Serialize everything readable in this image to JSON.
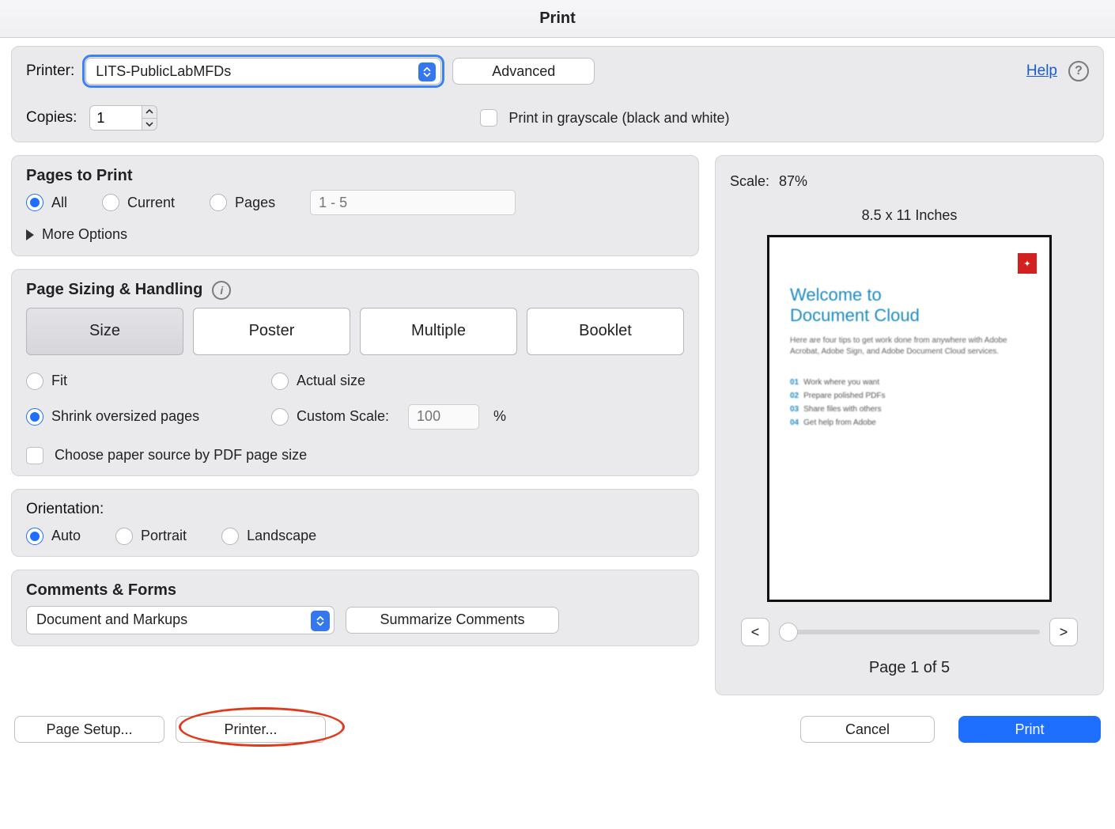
{
  "title": "Print",
  "header": {
    "printer_label": "Printer:",
    "printer_value": "LITS-PublicLabMFDs",
    "advanced": "Advanced",
    "help": "Help",
    "copies_label": "Copies:",
    "copies_value": "1",
    "grayscale_label": "Print in grayscale (black and white)"
  },
  "pages": {
    "title": "Pages to Print",
    "all": "All",
    "current": "Current",
    "pages_label": "Pages",
    "pages_placeholder": "1 - 5",
    "more_options": "More Options"
  },
  "sizing": {
    "title": "Page Sizing & Handling",
    "segments": {
      "size": "Size",
      "poster": "Poster",
      "multiple": "Multiple",
      "booklet": "Booklet"
    },
    "fit": "Fit",
    "actual": "Actual size",
    "shrink": "Shrink oversized pages",
    "custom": "Custom Scale:",
    "custom_value": "100",
    "custom_unit": "%",
    "paper_source": "Choose paper source by PDF page size"
  },
  "orientation": {
    "title": "Orientation:",
    "auto": "Auto",
    "portrait": "Portrait",
    "landscape": "Landscape"
  },
  "comments": {
    "title": "Comments & Forms",
    "value": "Document and Markups",
    "summarize": "Summarize Comments"
  },
  "preview": {
    "scale_label": "Scale:",
    "scale_value": "87%",
    "paper_size": "8.5 x 11 Inches",
    "doc_title_l1": "Welcome to",
    "doc_title_l2": "Document Cloud",
    "doc_sub": "Here are four tips to get work done from anywhere with Adobe Acrobat, Adobe Sign, and Adobe Document Cloud services.",
    "items": [
      "Work where you want",
      "Prepare polished PDFs",
      "Share files with others",
      "Get help from Adobe"
    ],
    "prev": "<",
    "next": ">",
    "page_indicator": "Page 1 of 5"
  },
  "footer": {
    "page_setup": "Page Setup...",
    "printer_btn": "Printer...",
    "cancel": "Cancel",
    "print": "Print"
  }
}
